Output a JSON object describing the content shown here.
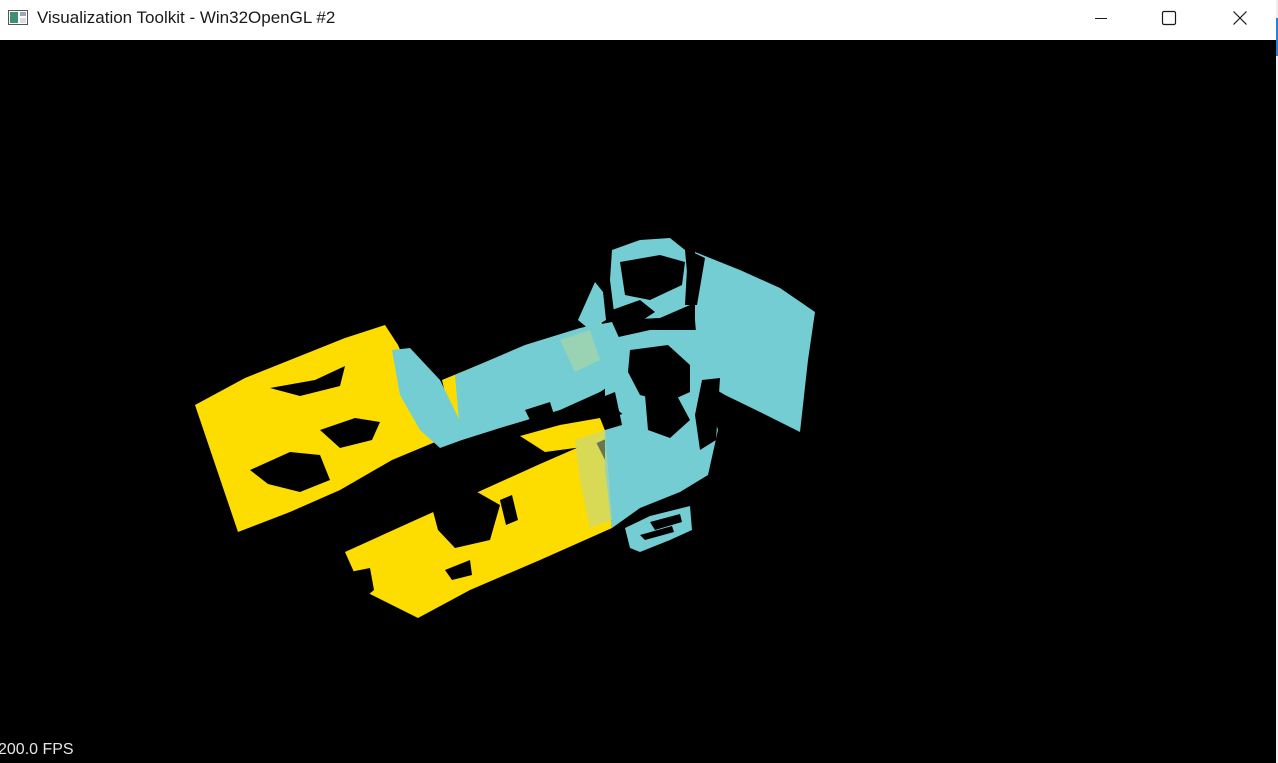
{
  "window": {
    "title": "Visualization Toolkit - Win32OpenGL #2"
  },
  "icons": {
    "app": "vtk-app-icon",
    "minimize": "minimize-icon",
    "maximize": "maximize-icon",
    "close": "close-icon"
  },
  "render": {
    "fps_label": "200.0 FPS"
  },
  "colors": {
    "background": "#000000",
    "point_cloud_a": "#FDDD00",
    "point_cloud_b": "#74CDD3",
    "titlebar": "#FFFFFF"
  }
}
